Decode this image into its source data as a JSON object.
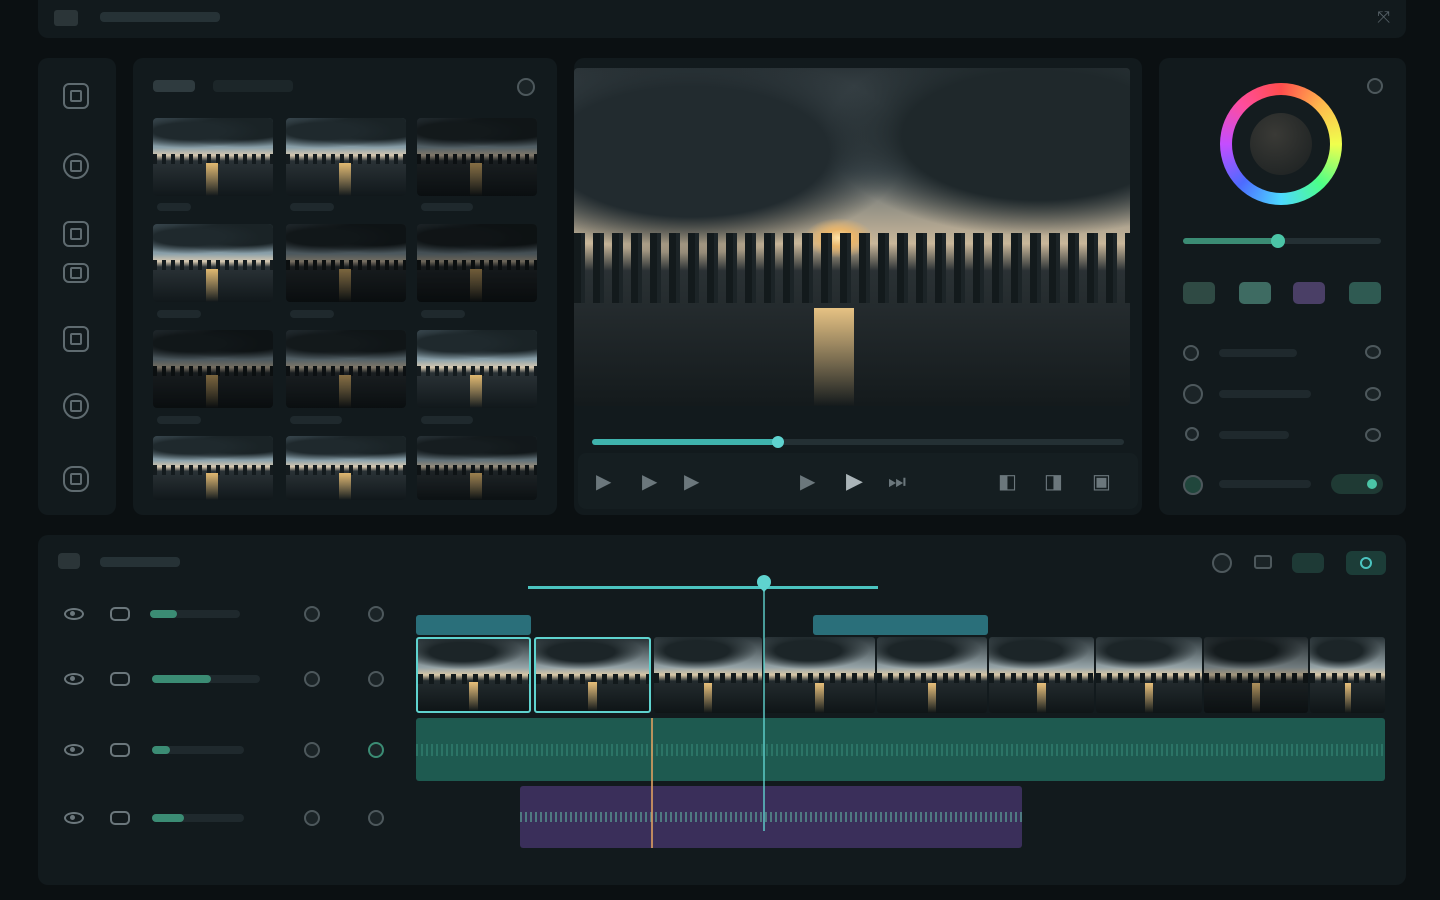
{
  "app": {
    "name": "video-editor"
  },
  "topbar": {
    "icons": [
      "folder-icon",
      "expand-icon"
    ]
  },
  "toolbar": {
    "icons": [
      "media-icon",
      "capture-icon",
      "effects-icon",
      "audio-icon",
      "text-icon",
      "transition-icon",
      "export-icon"
    ]
  },
  "media_browser": {
    "tabs": [
      {
        "active": true
      },
      {
        "active": false
      }
    ],
    "clips": 12
  },
  "preview": {
    "scrubber_progress": 0.35,
    "controls": [
      "play-icon",
      "step-back-icon",
      "step-forward-icon",
      "prev-frame-icon",
      "play-main-icon",
      "next-frame-icon",
      "split-icon",
      "snapshot-icon",
      "fullscreen-icon"
    ]
  },
  "inspector": {
    "color_wheel": "color-wheel",
    "slider_value": 0.48,
    "swatches": [
      "#2f4a44",
      "#3e6b62",
      "#4a3f66",
      "#2f5a52"
    ],
    "toggle_on": true
  },
  "timeline": {
    "tracks": [
      {
        "kind": "overlay",
        "level": 0.3
      },
      {
        "kind": "video",
        "level": 0.55
      },
      {
        "kind": "audio",
        "level": 0.2
      },
      {
        "kind": "audio",
        "level": 0.35
      }
    ],
    "playhead_color": "#5fd3cf",
    "accent": "#4bc4c0",
    "audio_color": "#1e5a50",
    "music_color": "#3a2f5a"
  }
}
